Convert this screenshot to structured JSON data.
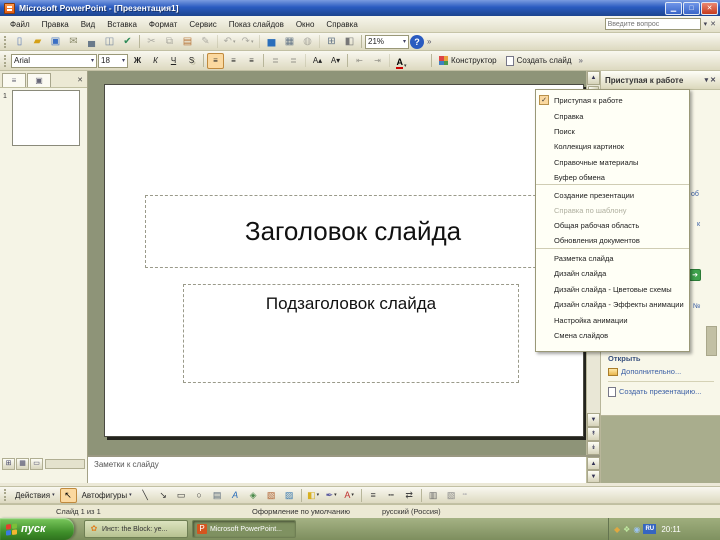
{
  "theme": {
    "titlebar_blue": "#2a5bc0",
    "selection": "#fbd9a0",
    "workspace": "#8e9478",
    "link_blue": "#3b5fa5",
    "taskbar_green": "#a5b284",
    "start_green": "#3f8f2a"
  },
  "glyphs": {
    "dropdown_arrow": "▾",
    "close": "✕",
    "check": "✓",
    "scroll_up": "▲",
    "scroll_down": "▼",
    "scroll_left": "◂",
    "scroll_right": "▸",
    "prev_slide": "↟",
    "next_slide": "↡",
    "toolbar_options": "»",
    "help": "?",
    "outline_tab": "≡",
    "slides_tab": "▣",
    "normal_view": "⊞",
    "sorter_view": "▦",
    "show_view": "▭",
    "select_arrow": "↖",
    "font_color_letter": "A",
    "online_arrow": "➔"
  },
  "window": {
    "title": "Microsoft PowerPoint - [Презентация1]",
    "controls": {
      "minimize": "▁",
      "maximize": "□",
      "close": "✕"
    }
  },
  "menu_bar": {
    "items": [
      {
        "label": "Файл"
      },
      {
        "label": "Правка"
      },
      {
        "label": "Вид"
      },
      {
        "label": "Вставка"
      },
      {
        "label": "Формат"
      },
      {
        "label": "Сервис"
      },
      {
        "label": "Показ слайдов"
      },
      {
        "label": "Окно"
      },
      {
        "label": "Справка"
      }
    ],
    "question_placeholder": "Введите вопрос"
  },
  "standard_toolbar": {
    "zoom_value": "21%",
    "icons": [
      {
        "name": "new-document-icon",
        "glyph": "▯",
        "color": "#5b7ab5"
      },
      {
        "name": "open-folder-icon",
        "glyph": "▰",
        "color": "#d4a017"
      },
      {
        "name": "save-icon",
        "glyph": "▣",
        "color": "#3b6fc4"
      },
      {
        "name": "email-icon",
        "glyph": "✉",
        "color": "#8a8a6a"
      },
      {
        "name": "print-icon",
        "glyph": "▄",
        "color": "#6a7a8a"
      },
      {
        "name": "print-preview-icon",
        "glyph": "◫",
        "color": "#7a8aa0"
      },
      {
        "name": "spelling-icon",
        "glyph": "✔",
        "color": "#2e8b57",
        "sep_after": true
      },
      {
        "name": "cut-icon",
        "glyph": "✂",
        "color": "#555",
        "disabled": true
      },
      {
        "name": "copy-icon",
        "glyph": "⧉",
        "color": "#555",
        "disabled": true
      },
      {
        "name": "paste-icon",
        "glyph": "▤",
        "color": "#b8763a"
      },
      {
        "name": "format-painter-icon",
        "glyph": "✎",
        "color": "#555",
        "disabled": true,
        "sep_after": true
      },
      {
        "name": "undo-icon",
        "glyph": "↶",
        "color": "#555",
        "disabled": true,
        "dropdown": true
      },
      {
        "name": "redo-icon",
        "glyph": "↷",
        "color": "#555",
        "disabled": true,
        "dropdown": true,
        "sep_after": true
      },
      {
        "name": "chart-icon",
        "glyph": "▅",
        "color": "#2a6ebb"
      },
      {
        "name": "table-icon",
        "glyph": "▦",
        "color": "#667788"
      },
      {
        "name": "hyperlink-icon",
        "glyph": "◍",
        "color": "#555",
        "disabled": true,
        "sep_after": true
      },
      {
        "name": "show-grid-icon",
        "glyph": "⊞",
        "color": "#667788"
      },
      {
        "name": "color-grayscale-icon",
        "glyph": "◧",
        "color": "#777777",
        "sep_after": true
      }
    ]
  },
  "formatting_toolbar": {
    "font_name": "Arial",
    "font_size": "18",
    "buttons": [
      {
        "name": "bold-icon",
        "glyph": "Ж",
        "bold": true
      },
      {
        "name": "italic-icon",
        "glyph": "К",
        "italic": true
      },
      {
        "name": "underline-icon",
        "glyph": "Ч",
        "underline": true
      },
      {
        "name": "shadow-icon",
        "glyph": "S",
        "shadow": true,
        "sep_after": true
      },
      {
        "name": "align-left-icon",
        "glyph": "≡",
        "selected": true
      },
      {
        "name": "align-center-icon",
        "glyph": "≡"
      },
      {
        "name": "align-right-icon",
        "glyph": "≡",
        "sep_after": true
      },
      {
        "name": "numbering-icon",
        "glyph": "≣",
        "disabled": true
      },
      {
        "name": "bullets-icon",
        "glyph": "≣",
        "disabled": true,
        "sep_after": true
      },
      {
        "name": "increase-font-icon",
        "glyph": "A▴"
      },
      {
        "name": "decrease-font-icon",
        "glyph": "A▾",
        "sep_after": true
      },
      {
        "name": "decrease-indent-icon",
        "glyph": "⇤",
        "disabled": true
      },
      {
        "name": "increase-indent-icon",
        "glyph": "⇥",
        "disabled": true,
        "sep_after": true
      }
    ],
    "design_label": "Конструктор",
    "new_slide_label": "Создать слайд"
  },
  "slides_pane": {
    "slide_number": "1"
  },
  "slide": {
    "title_placeholder": "Заголовок слайда",
    "subtitle_placeholder": "Подзаголовок слайда"
  },
  "task_pane": {
    "title": "Приступая к работе",
    "menu_items": [
      {
        "label": "Приступая к работе",
        "checked": true
      },
      {
        "label": "Справка"
      },
      {
        "label": "Поиск"
      },
      {
        "label": "Коллекция картинок"
      },
      {
        "label": "Справочные материалы"
      },
      {
        "label": "Буфер обмена",
        "sep_after": true
      },
      {
        "label": "Создание презентации"
      },
      {
        "label": "Справка по шаблону",
        "disabled": true
      },
      {
        "label": "Общая рабочая область"
      },
      {
        "label": "Обновления документов",
        "sep_after": true
      },
      {
        "label": "Разметка слайда"
      },
      {
        "label": "Дизайн слайда"
      },
      {
        "label": "Дизайн слайда - Цветовые схемы"
      },
      {
        "label": "Дизайн слайда - Эффекты анимации"
      },
      {
        "label": "Настройка анимации"
      },
      {
        "label": "Смена слайдов"
      }
    ],
    "open_header": "Открыть",
    "more_link": "Дополнительно...",
    "create_link": "Создать презентацию...",
    "fragments": {
      "f1": "об",
      "f2": "к",
      "f3": "№"
    }
  },
  "notes": {
    "placeholder": "Заметки к слайду"
  },
  "drawing_toolbar": {
    "draw_label": "Действия",
    "autoshapes_label": "Автофигуры",
    "icons": [
      {
        "name": "line-icon",
        "glyph": "╲",
        "color": "#333333"
      },
      {
        "name": "arrow-icon",
        "glyph": "↘",
        "color": "#333333"
      },
      {
        "name": "rectangle-icon",
        "glyph": "▭",
        "color": "#333333"
      },
      {
        "name": "oval-icon",
        "glyph": "○",
        "color": "#333333"
      },
      {
        "name": "textbox-icon",
        "glyph": "▤",
        "color": "#556677"
      },
      {
        "name": "wordart-icon",
        "glyph": "A",
        "color": "#2a6ebb",
        "italic": true
      },
      {
        "name": "diagram-icon",
        "glyph": "◈",
        "color": "#4a8a4a"
      },
      {
        "name": "clipart-icon",
        "glyph": "▧",
        "color": "#b06030"
      },
      {
        "name": "picture-icon",
        "glyph": "▨",
        "color": "#3a7ab0",
        "sep_after": true
      },
      {
        "name": "fill-color-icon",
        "glyph": "◧",
        "color": "#d8b020",
        "dropdown": true
      },
      {
        "name": "line-color-icon",
        "glyph": "✒",
        "color": "#5a5aa0",
        "dropdown": true
      },
      {
        "name": "font-color-icon",
        "glyph": "A",
        "color": "#c03030",
        "dropdown": true,
        "sep_after": true
      },
      {
        "name": "line-style-icon",
        "glyph": "≡",
        "color": "#444444"
      },
      {
        "name": "dash-style-icon",
        "glyph": "┅",
        "color": "#444444"
      },
      {
        "name": "arrow-style-icon",
        "glyph": "⇄",
        "color": "#444444",
        "sep_after": true
      },
      {
        "name": "shadow-style-icon",
        "glyph": "▥",
        "color": "#666666"
      },
      {
        "name": "3d-style-icon",
        "glyph": "▧",
        "color": "#888888"
      }
    ],
    "endgrid_glyph": "▫▫"
  },
  "status_bar": {
    "slide_info": "Слайд 1 из 1",
    "design_info": "Оформление по умолчанию",
    "language": "русский (Россия)"
  },
  "taskbar": {
    "start_label": "пуск",
    "windows": [
      {
        "label": "Инст: the Block: уе...",
        "icon_glyph": "✿",
        "icon_color": "#e08020",
        "active": false
      },
      {
        "label": "Microsoft PowerPoint...",
        "icon_glyph": "P",
        "icon_color": "#ffffff",
        "icon_bg": "#d4551f",
        "active": true
      }
    ],
    "clock": "20:11"
  }
}
